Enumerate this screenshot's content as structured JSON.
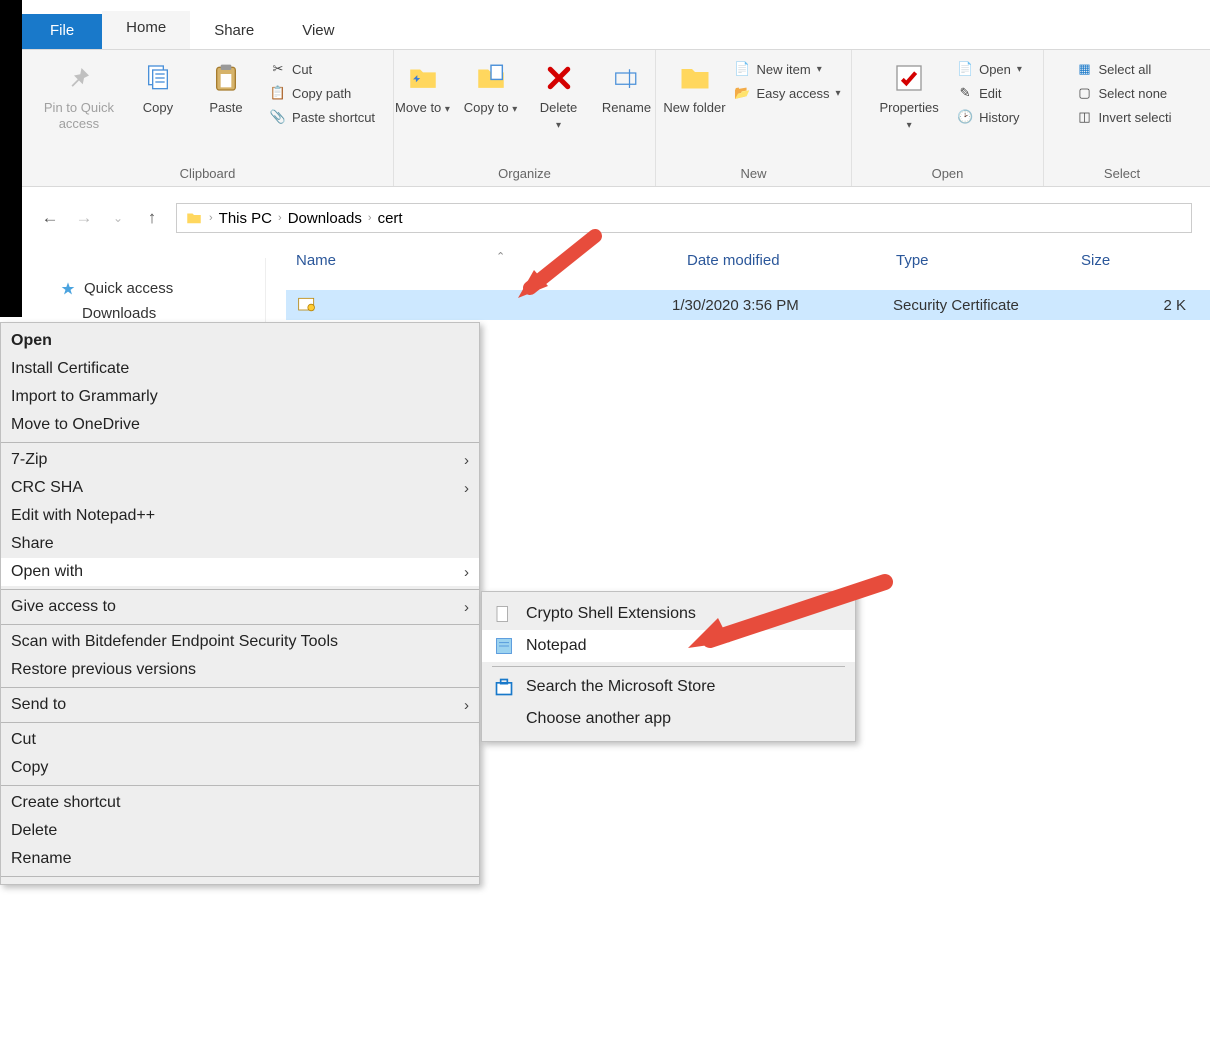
{
  "tabs": {
    "file": "File",
    "home": "Home",
    "share": "Share",
    "view": "View"
  },
  "ribbon": {
    "clipboard": {
      "label": "Clipboard",
      "pin": "Pin to Quick access",
      "copy": "Copy",
      "paste": "Paste",
      "cut": "Cut",
      "copypath": "Copy path",
      "pasteshortcut": "Paste shortcut"
    },
    "organize": {
      "label": "Organize",
      "moveto": "Move to",
      "copyto": "Copy to",
      "delete": "Delete",
      "rename": "Rename"
    },
    "new": {
      "label": "New",
      "newfolder": "New folder",
      "newitem": "New item",
      "easyaccess": "Easy access"
    },
    "open": {
      "label": "Open",
      "properties": "Properties",
      "open": "Open",
      "edit": "Edit",
      "history": "History"
    },
    "select": {
      "label": "Select",
      "all": "Select all",
      "none": "Select none",
      "invert": "Invert selecti"
    }
  },
  "breadcrumb": {
    "pc": "This PC",
    "dl": "Downloads",
    "cert": "cert"
  },
  "sidebar": {
    "quick": "Quick access",
    "downloads": "Downloads"
  },
  "columns": {
    "name": "Name",
    "date": "Date modified",
    "type": "Type",
    "size": "Size"
  },
  "file": {
    "date": "1/30/2020 3:56 PM",
    "type": "Security Certificate",
    "size": "2 K"
  },
  "ctx": {
    "open": "Open",
    "install": "Install Certificate",
    "grammarly": "Import to Grammarly",
    "onedrive": "Move to OneDrive",
    "zip": "7-Zip",
    "crc": "CRC SHA",
    "npp": "Edit with Notepad++",
    "share": "Share",
    "openwith": "Open with",
    "giveaccess": "Give access to",
    "bitdefender": "Scan with Bitdefender Endpoint Security Tools",
    "restore": "Restore previous versions",
    "sendto": "Send to",
    "cut": "Cut",
    "copy": "Copy",
    "shortcut": "Create shortcut",
    "delete": "Delete",
    "rename": "Rename"
  },
  "submenu": {
    "crypto": "Crypto Shell Extensions",
    "notepad": "Notepad",
    "store": "Search the Microsoft Store",
    "choose": "Choose another app"
  }
}
